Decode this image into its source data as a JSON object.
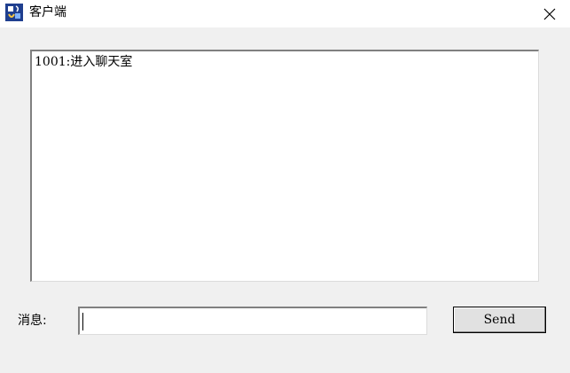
{
  "window": {
    "title": "客户端",
    "app_icon": "java-app-icon",
    "close_icon": "close-icon"
  },
  "chat": {
    "lines": [
      "1001:进入聊天室"
    ]
  },
  "message": {
    "label": "消息:",
    "value": "",
    "placeholder": ""
  },
  "actions": {
    "send_label": "Send"
  },
  "colors": {
    "window_bg": "#f0f0f0",
    "titlebar_bg": "#ffffff",
    "field_bg": "#ffffff",
    "button_bg": "#e1e1e1"
  }
}
